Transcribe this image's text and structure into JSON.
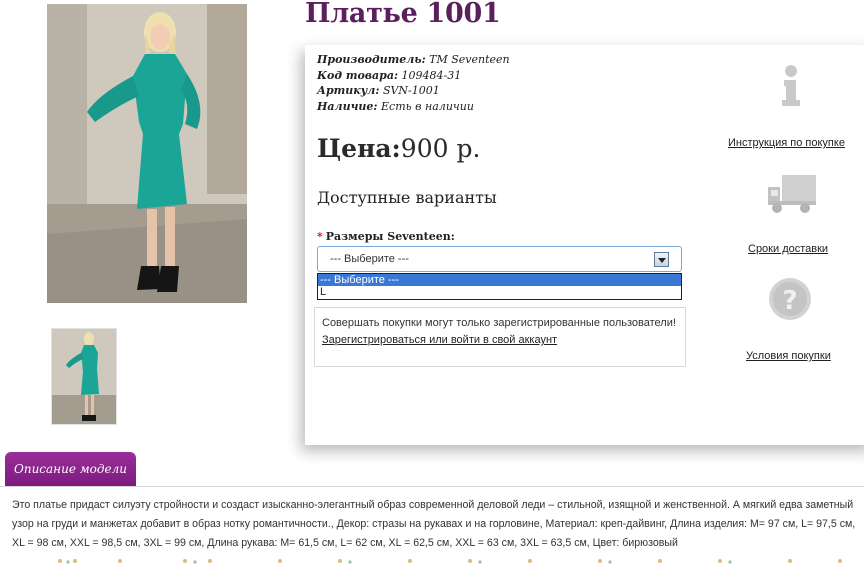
{
  "product": {
    "title": "Платье 1001"
  },
  "meta": [
    {
      "key": "Производитель:",
      "value": "TM Seventeen"
    },
    {
      "key": "Код товара:",
      "value": "109484-31"
    },
    {
      "key": "Артикул:",
      "value": "SVN-1001"
    },
    {
      "key": "Наличие:",
      "value": "Есть в наличии"
    }
  ],
  "price": {
    "label": "Цена:",
    "value": "900 р."
  },
  "variants": {
    "title": "Доступные варианты",
    "required_mark": "*",
    "size_label": "Размеры Seventeen:",
    "select_value": "--- Выберите ---",
    "options": [
      "--- Выберите ---",
      "L"
    ]
  },
  "notice": {
    "text": "Совершать покупки могут только зарегистрированные пользователи!",
    "link": "Зарегистрироваться или войти в свой аккаунт"
  },
  "side_links": [
    {
      "label": "Инструкция по покупке",
      "icon": "info-icon"
    },
    {
      "label": "Сроки доставки",
      "icon": "truck-icon"
    },
    {
      "label": "Условия покупки",
      "icon": "question-icon"
    }
  ],
  "description": {
    "tab_label": "Описание модели",
    "text": "Это платье придаст силуэту стройности и создаст изысканно-элегантный образ современной деловой леди – стильной, изящной и женственной. А мягкий едва заметный узор на груди и манжетах добавит в образ нотку романтичности., Декор: стразы на рукавах и на горловине, Материал: креп-дайвинг, Длина изделия: M= 97 см, L= 97,5 см, XL = 98 см, XXL = 98,5 см, 3XL = 99 см, Длина рукава: M= 61,5 см, L= 62 см, XL = 62,5 см, XXL = 63 см, 3XL = 63,5 см, Цвет: бирюзовый"
  },
  "colors": {
    "title": "#5b1f5e",
    "tab": "#8a238c",
    "dress": "#1aa596",
    "select_border": "#7aa7d6",
    "option_highlight": "#3a78d6"
  }
}
